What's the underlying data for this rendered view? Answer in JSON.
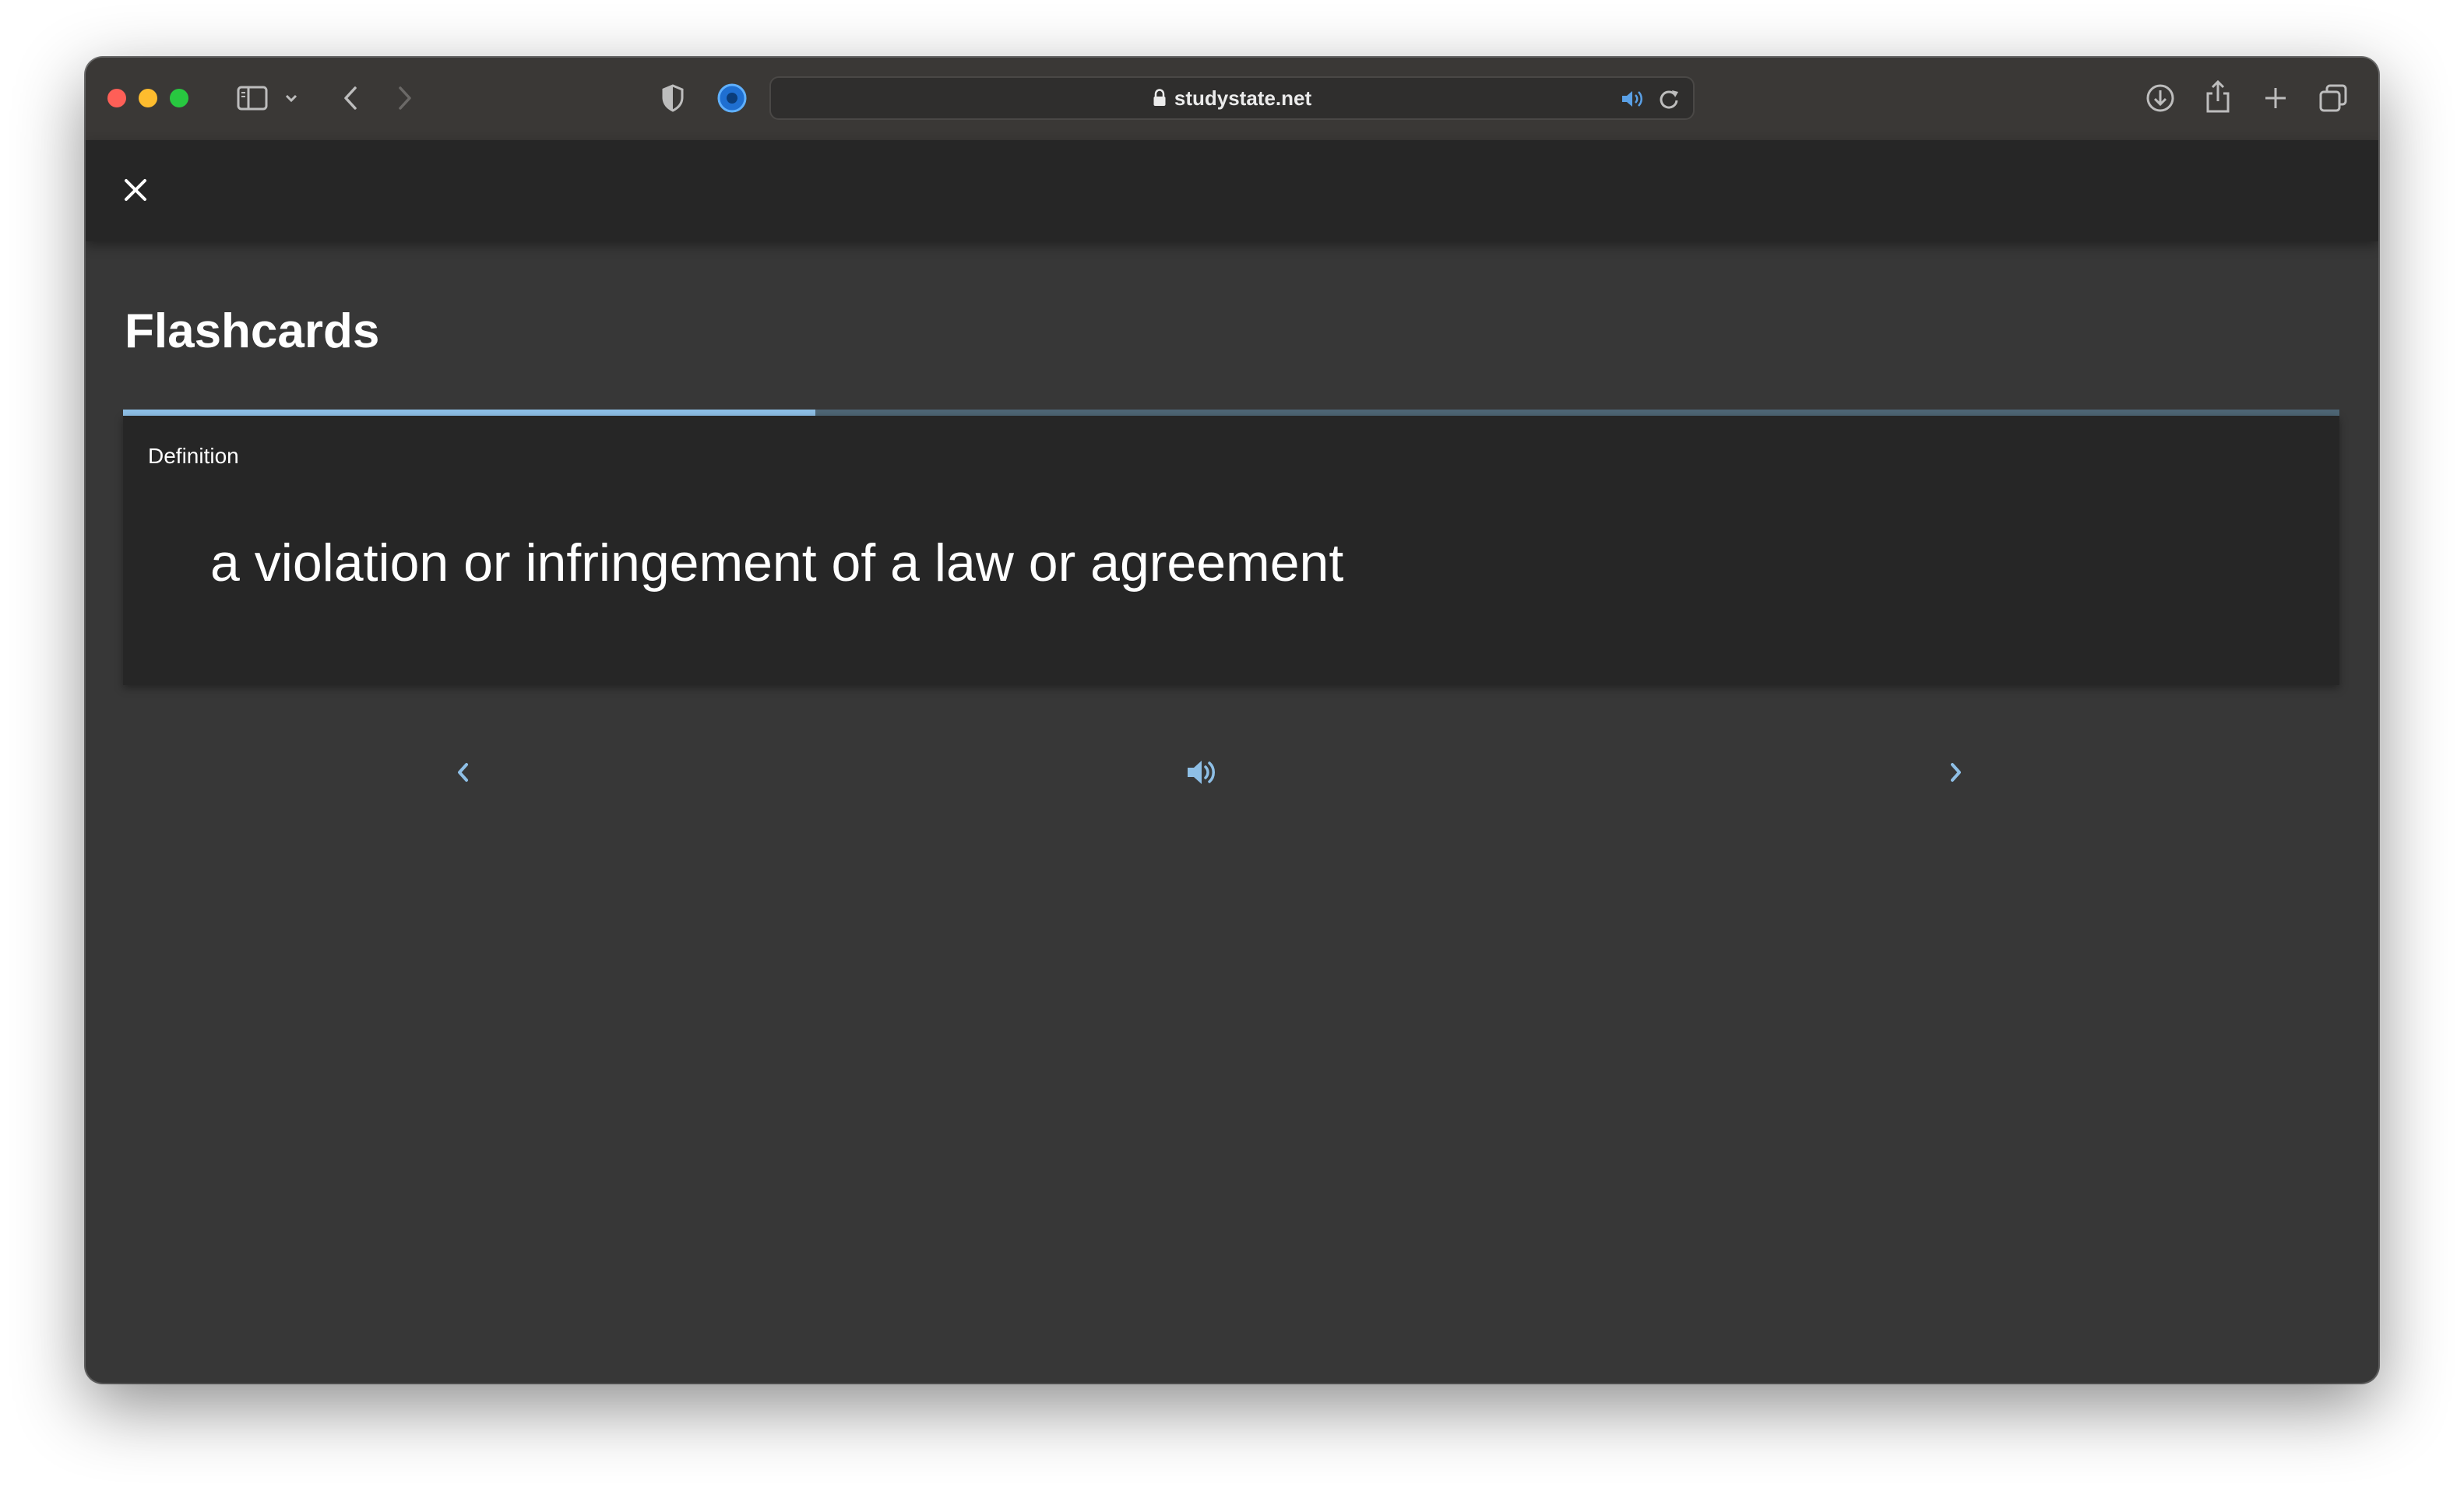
{
  "browser": {
    "url": "studystate.net",
    "icons": {
      "sidebar": "sidebar-icon",
      "sidebar_menu": "chevron-down-icon",
      "back": "chevron-left-icon",
      "forward": "chevron-right-icon",
      "privacy": "shield-icon",
      "extension": "extension-icon",
      "lock": "lock-icon",
      "audio": "speaker-icon",
      "reload": "reload-icon",
      "downloads": "download-icon",
      "share": "share-icon",
      "new_tab": "plus-icon",
      "tabs": "tab-overview-icon"
    },
    "traffic_colors": [
      "#fe5f57",
      "#febc2e",
      "#28c840"
    ]
  },
  "app": {
    "close_icon": "close-icon",
    "title": "Flashcards",
    "progress": 0.3125,
    "colors": {
      "accent": "#8ebfe6",
      "track": "#4e6675",
      "card_bg": "#262626",
      "page_bg": "#373737"
    }
  },
  "card": {
    "label": "Definition",
    "text": "a violation or infringement of a law or agreement"
  },
  "controls": {
    "previous_icon": "chevron-left-icon",
    "audio_icon": "speaker-icon",
    "next_icon": "chevron-right-icon"
  }
}
